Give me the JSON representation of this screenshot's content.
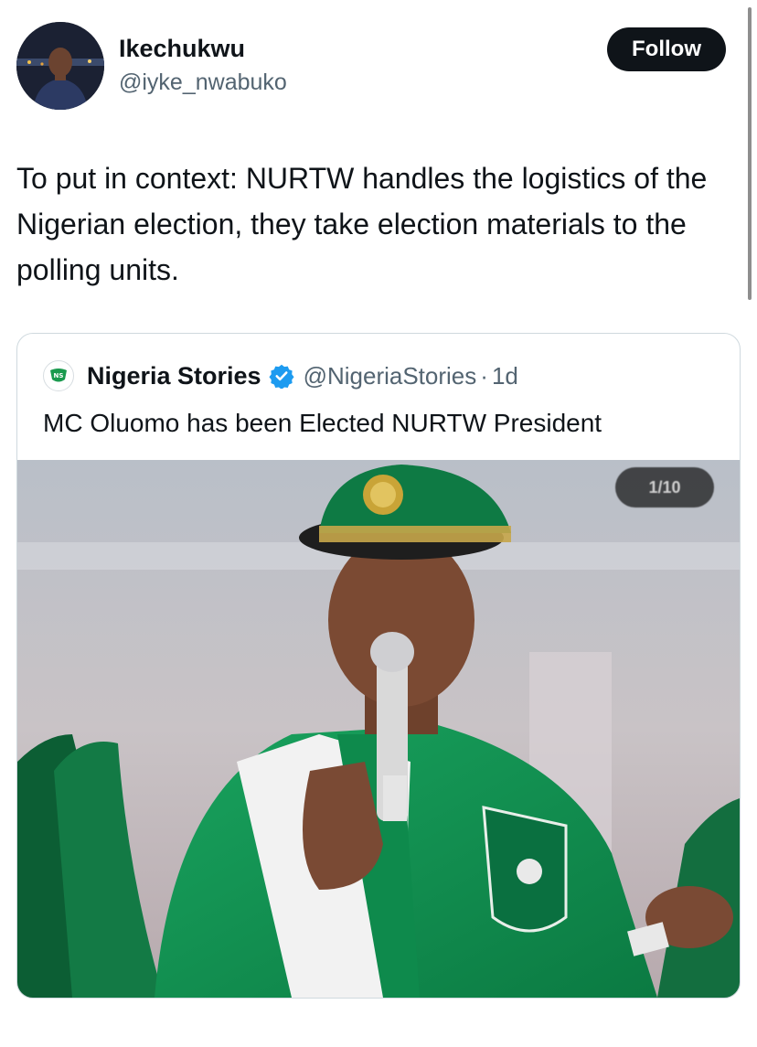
{
  "author": {
    "display_name": "Ikechukwu",
    "handle": "@iyke_nwabuko",
    "follow_label": "Follow"
  },
  "tweet": {
    "text": "To put in context: NURTW handles the logistics of the Nigerian election, they take election materials to the polling units."
  },
  "quoted_tweet": {
    "avatar_initials": "NS",
    "display_name": "Nigeria Stories",
    "verified": true,
    "handle": "@NigeriaStories",
    "separator": "·",
    "time": "1d",
    "text": "MC Oluomo has been Elected NURTW President",
    "media_counter": "1/10"
  },
  "colors": {
    "follow_bg": "#0f1419",
    "verified": "#1d9bf0",
    "uniform_green": "#0e8a4c",
    "secondary_text": "#536471"
  }
}
